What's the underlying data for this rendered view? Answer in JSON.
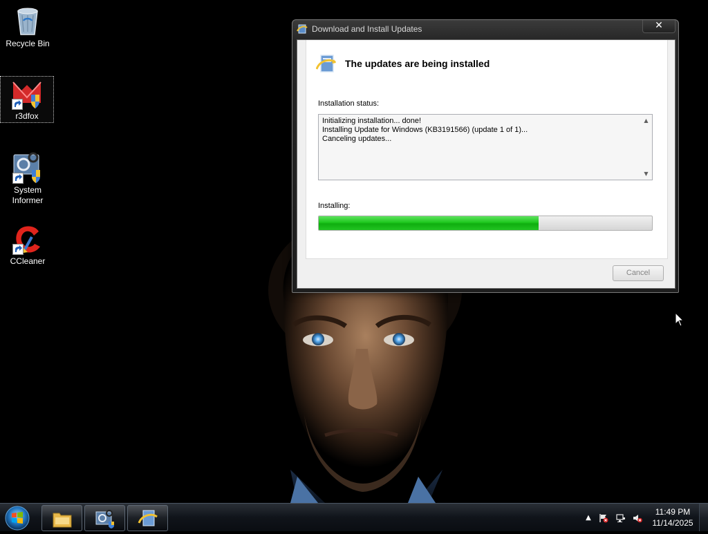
{
  "desktop": {
    "icons": [
      {
        "label": "Recycle Bin",
        "icon": "recycle-bin-icon"
      },
      {
        "label": "r3dfox",
        "icon": "r3dfox-icon"
      },
      {
        "label": "System Informer",
        "icon": "system-informer-icon"
      },
      {
        "label": "CCleaner",
        "icon": "ccleaner-icon"
      }
    ]
  },
  "window": {
    "title": "Download and Install Updates",
    "close_label": "✕",
    "heading": "The updates are being installed",
    "status_label": "Installation status:",
    "status_lines": [
      "Initializing installation... done!",
      "Installing Update for Windows (KB3191566) (update 1 of 1)...",
      "Canceling updates..."
    ],
    "installing_label": "Installing:",
    "progress_percent": 66,
    "cancel_label": "Cancel"
  },
  "taskbar": {
    "pinned": [
      {
        "icon": "file-explorer-icon"
      },
      {
        "icon": "system-informer-icon"
      },
      {
        "icon": "windows-update-icon"
      }
    ],
    "tray": {
      "show_hidden_label": "▲"
    },
    "clock": {
      "time": "11:49 PM",
      "date": "11/14/2025"
    }
  },
  "colors": {
    "progress_fill": "#1ec81e",
    "wallpaper_bg": "#000000",
    "taskbar_bg": "#10141a"
  }
}
